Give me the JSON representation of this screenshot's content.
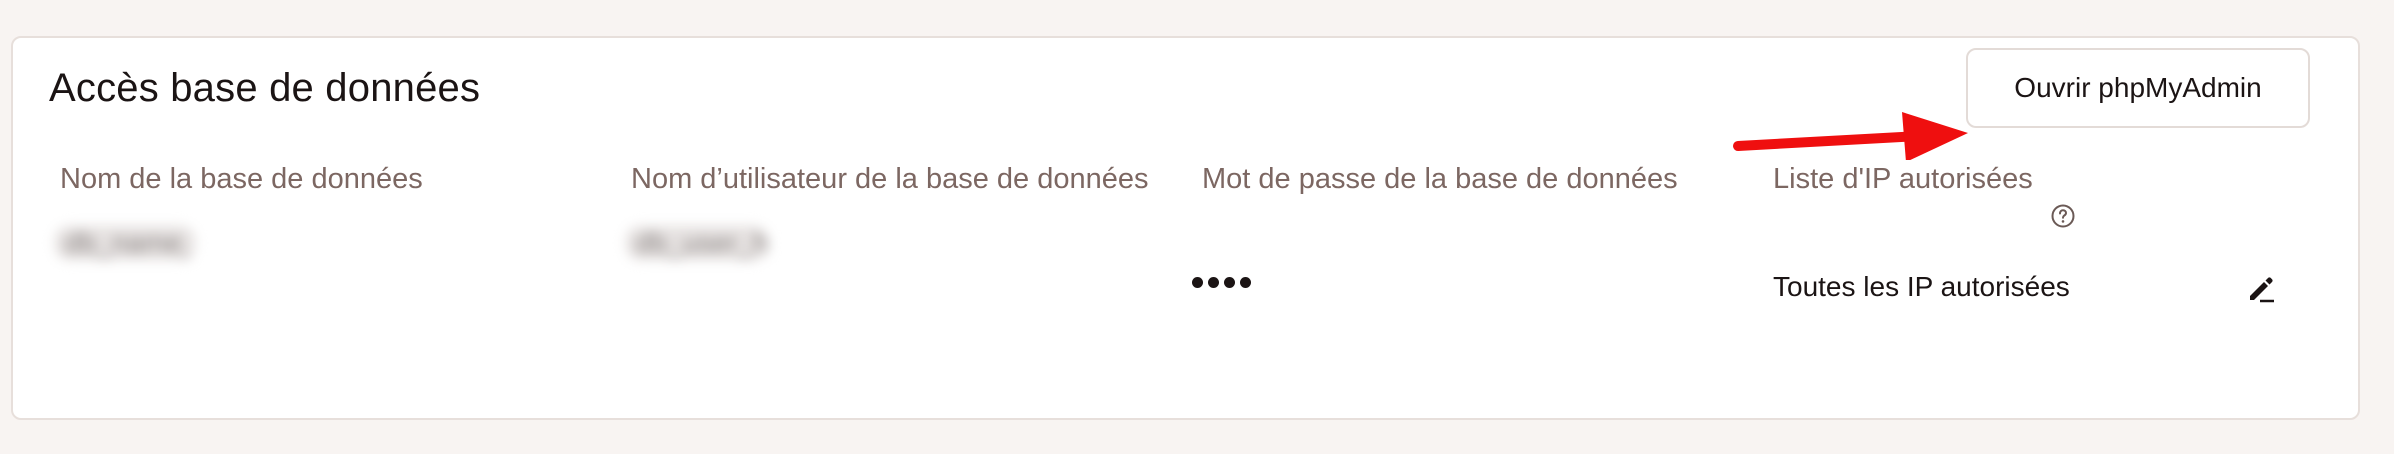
{
  "section": {
    "title": "Accès base de données",
    "open_button_label": "Ouvrir phpMyAdmin"
  },
  "columns": [
    {
      "header": "Nom de la base de données",
      "value": "db_name_hidden",
      "value_state": "blurred"
    },
    {
      "header": "Nom d’utilisateur de la base de données",
      "value": "db_user_hidden",
      "value_state": "blurred"
    },
    {
      "header": "Mot de passe de la base de données",
      "value_state": "masked-dots"
    },
    {
      "header": "Liste d'IP autorisées",
      "value": "Toutes les IP autorisées"
    }
  ],
  "icons": {
    "help": "question-circle-icon",
    "edit": "pencil-edit-icon",
    "annotation": "red-arrow-icon"
  },
  "colors": {
    "page_background": "#f8f4f2",
    "card_background": "#ffffff",
    "header_text": "#7c6762",
    "body_text": "#1b1414",
    "annotation_arrow": "#ef0f0f"
  }
}
